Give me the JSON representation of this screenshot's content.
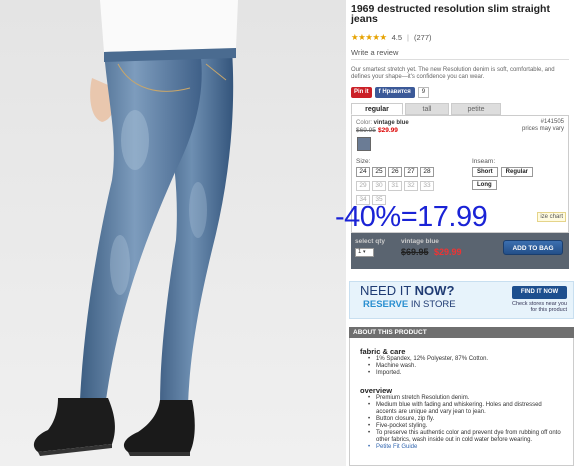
{
  "product": {
    "title": "1969 destructed resolution slim straight jeans",
    "stars": "★★★★★",
    "rating": "4.5",
    "review_count": "(277)",
    "write_review": "Write a review",
    "description": "Our smartest stretch yet. The new Resolution denim is soft, comfortable, and defines your shape—it's confidence you can wear.",
    "pin_label": "Pin it",
    "fb_label": "Нравится",
    "fb_count": "9"
  },
  "fit_tabs": [
    {
      "label": "regular",
      "active": true
    },
    {
      "label": "tall",
      "active": false
    },
    {
      "label": "petite",
      "active": false
    }
  ],
  "selector": {
    "color_prefix": "Color: ",
    "color_name": "vintage blue",
    "old_price": "$69.95",
    "new_price": "$29.99",
    "style_no": "#141505",
    "prices_vary": "prices may vary",
    "swatch_color": "#6b7c95",
    "size_label": "Size:",
    "sizes": [
      {
        "label": "24",
        "available": true
      },
      {
        "label": "25",
        "available": true
      },
      {
        "label": "26",
        "available": true
      },
      {
        "label": "27",
        "available": true
      },
      {
        "label": "28",
        "available": true
      },
      {
        "label": "29",
        "available": false
      },
      {
        "label": "30",
        "available": false
      },
      {
        "label": "31",
        "available": false
      },
      {
        "label": "32",
        "available": false
      },
      {
        "label": "33",
        "available": false
      },
      {
        "label": "34",
        "available": false
      },
      {
        "label": "35",
        "available": false
      }
    ],
    "inseam_label": "Inseam:",
    "inseams": [
      "Short",
      "Regular",
      "Long"
    ],
    "size_chart": "ize chart"
  },
  "overlay_text": "-40%=17.99",
  "purchase": {
    "qty_label": "select qty",
    "qty_value": "1",
    "color_name": "vintage blue",
    "old_price": "$69.95",
    "new_price": "$29.99",
    "add_to_bag": "ADD TO BAG"
  },
  "reserve": {
    "need": "NEED IT ",
    "now": "NOW?",
    "reserve": "RESERVE",
    "in_store": " IN STORE",
    "find_button": "FIND IT NOW",
    "check_text": "Check stores near you for this product"
  },
  "about": {
    "header": "ABOUT THIS PRODUCT",
    "fabric_title": "fabric & care",
    "fabric_items": [
      "1% Spandex, 12% Polyester, 87% Cotton.",
      "Machine wash.",
      "Imported."
    ],
    "overview_title": "overview",
    "overview_items": [
      "Premium stretch Resolution denim.",
      "Medium blue with fading and whiskering. Holes and distressed accents are unique and vary jean to jean.",
      "Button closure, zip fly.",
      "Five-pocket styling.",
      "To preserve this authentic color and prevent dye from rubbing off onto other fabrics, wash inside out in cold water before wearing."
    ],
    "guide_link": "Petite Fit Guide"
  },
  "colors": {
    "sale_red": "#dd0000",
    "overlay_blue": "#1a23d6",
    "button_blue": "#234f88"
  }
}
